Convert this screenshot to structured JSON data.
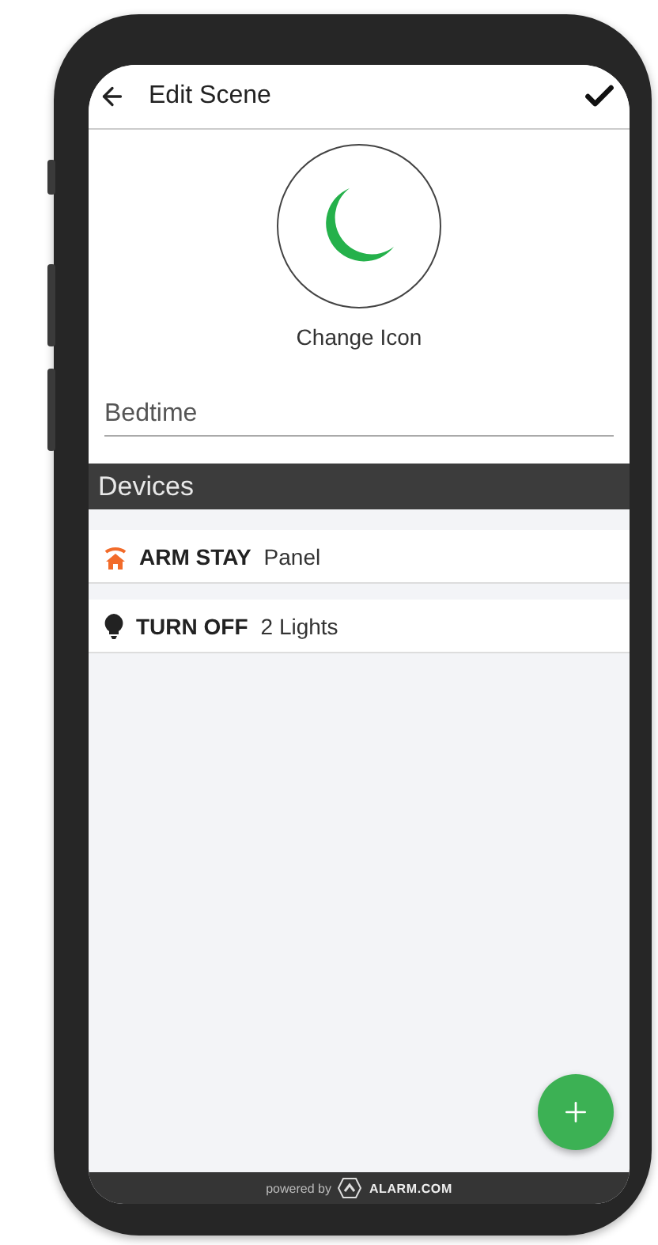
{
  "header": {
    "title": "Edit Scene"
  },
  "scene_icon": {
    "label": "Change Icon"
  },
  "name_field": {
    "value": "Bedtime"
  },
  "section": {
    "title": "Devices"
  },
  "devices": [
    {
      "kind": "arm",
      "action": "ARM STAY",
      "target": "Panel"
    },
    {
      "kind": "light",
      "action": "TURN OFF",
      "target": "2 Lights"
    }
  ],
  "footer": {
    "powered_by": "powered by",
    "brand": "ALARM.COM"
  }
}
